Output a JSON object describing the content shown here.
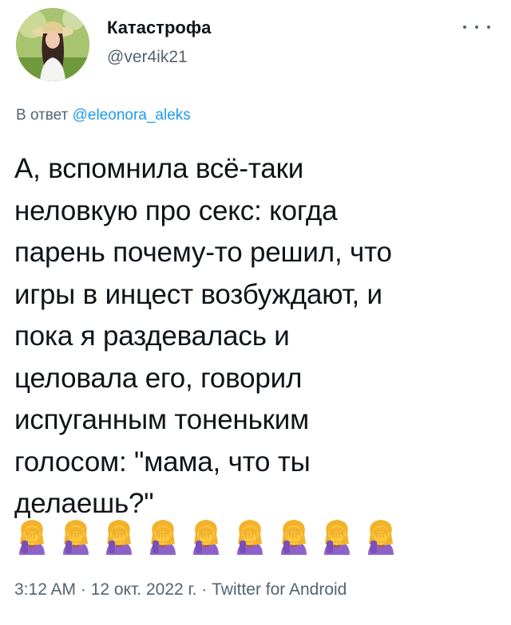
{
  "tweet": {
    "author": {
      "name": "Катастрофа",
      "handle": "@ver4ik21",
      "avatar_icon": "profile-photo"
    },
    "menu_icon": "more-options-icon",
    "reply": {
      "prefix": "В ответ",
      "mention": "@eleonora_aleks"
    },
    "text": "А, вспомнила всё-таки\nнеловкую про секс: когда\nпарень почему-то решил, что\nигры в инцест возбуждают, и\nпока я раздевалась и\nцеловала его, говорил\nиспуганным тоненьким\nголосом:  \"мама, что ты\nделаешь?\"",
    "emojis": {
      "icon": "woman-facepalming-emoji",
      "count": 9
    },
    "meta": "3:12 AM · 12 окт. 2022 г. · Twitter for Android"
  },
  "colors": {
    "text": "#0f1419",
    "secondary": "#536471",
    "link": "#1d9bf0"
  }
}
